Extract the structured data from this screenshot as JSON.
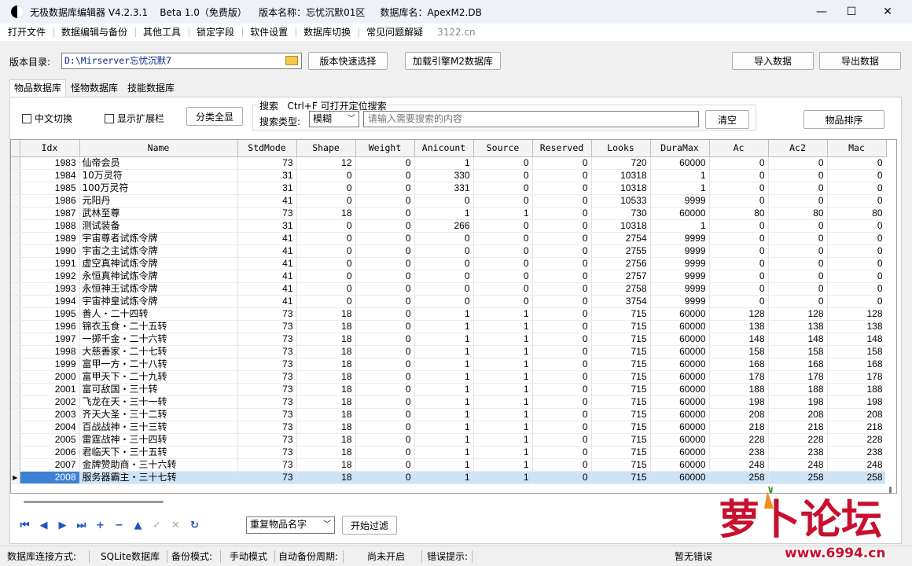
{
  "window": {
    "title": "无极数据库编辑器 V4.2.3.1    Beta 1.0（免费版）    版本名称：忘忧沉默01区     数据库名：ApexM2.DB",
    "minimize_glyph": "—",
    "maximize_glyph": "☐",
    "close_glyph": "✕"
  },
  "menu": {
    "items": [
      "打开文件",
      "数据编辑与备份",
      "其他工具",
      "锁定字段",
      "软件设置",
      "数据库切换",
      "常见问题解疑"
    ],
    "site": "3122.cn"
  },
  "toolbar": {
    "dir_label": "版本目录:",
    "dir_value": "D:\\Mirserver忘忧沉默7",
    "quick_select": "版本快速选择",
    "load_engine": "加载引擎M2数据库",
    "import": "导入数据",
    "export": "导出数据"
  },
  "tabs": [
    "物品数据库",
    "怪物数据库",
    "技能数据库"
  ],
  "options": {
    "chinese_switch": "中文切换",
    "show_ext": "显示扩展栏",
    "show_all": "分类全显",
    "search_group": "搜索   Ctrl+F 可打开定位搜索",
    "search_type_label": "搜索类型:",
    "search_type_value": "模糊",
    "search_placeholder": "请输入需要搜索的内容",
    "clear": "清空",
    "sort": "物品排序"
  },
  "grid": {
    "columns": [
      "Idx",
      "Name",
      "StdMode",
      "Shape",
      "Weight",
      "Anicount",
      "Source",
      "Reserved",
      "Looks",
      "DuraMax",
      "Ac",
      "Ac2",
      "Mac"
    ],
    "rows": [
      [
        "1983",
        "仙帝会员",
        "73",
        "12",
        "0",
        "1",
        "0",
        "0",
        "720",
        "60000",
        "0",
        "0",
        "0"
      ],
      [
        "1984",
        "10万灵符",
        "31",
        "0",
        "0",
        "330",
        "0",
        "0",
        "10318",
        "1",
        "0",
        "0",
        "0"
      ],
      [
        "1985",
        "100万灵符",
        "31",
        "0",
        "0",
        "331",
        "0",
        "0",
        "10318",
        "1",
        "0",
        "0",
        "0"
      ],
      [
        "1986",
        "元阳丹",
        "41",
        "0",
        "0",
        "0",
        "0",
        "0",
        "10533",
        "9999",
        "0",
        "0",
        "0"
      ],
      [
        "1987",
        "武林至尊",
        "73",
        "18",
        "0",
        "1",
        "1",
        "0",
        "730",
        "60000",
        "80",
        "80",
        "80"
      ],
      [
        "1988",
        "测试装备",
        "31",
        "0",
        "0",
        "266",
        "0",
        "0",
        "10318",
        "1",
        "0",
        "0",
        "0"
      ],
      [
        "1989",
        "宇宙尊者试炼令牌",
        "41",
        "0",
        "0",
        "0",
        "0",
        "0",
        "2754",
        "9999",
        "0",
        "0",
        "0"
      ],
      [
        "1990",
        "宇宙之主试炼令牌",
        "41",
        "0",
        "0",
        "0",
        "0",
        "0",
        "2755",
        "9999",
        "0",
        "0",
        "0"
      ],
      [
        "1991",
        "虚空真神试炼令牌",
        "41",
        "0",
        "0",
        "0",
        "0",
        "0",
        "2756",
        "9999",
        "0",
        "0",
        "0"
      ],
      [
        "1992",
        "永恒真神试炼令牌",
        "41",
        "0",
        "0",
        "0",
        "0",
        "0",
        "2757",
        "9999",
        "0",
        "0",
        "0"
      ],
      [
        "1993",
        "永恒神王试炼令牌",
        "41",
        "0",
        "0",
        "0",
        "0",
        "0",
        "2758",
        "9999",
        "0",
        "0",
        "0"
      ],
      [
        "1994",
        "宇宙神皇试炼令牌",
        "41",
        "0",
        "0",
        "0",
        "0",
        "0",
        "3754",
        "9999",
        "0",
        "0",
        "0"
      ],
      [
        "1995",
        "善人・二十四转",
        "73",
        "18",
        "0",
        "1",
        "1",
        "0",
        "715",
        "60000",
        "128",
        "128",
        "128"
      ],
      [
        "1996",
        "锦衣玉食・二十五转",
        "73",
        "18",
        "0",
        "1",
        "1",
        "0",
        "715",
        "60000",
        "138",
        "138",
        "138"
      ],
      [
        "1997",
        "一掷千金・二十六转",
        "73",
        "18",
        "0",
        "1",
        "1",
        "0",
        "715",
        "60000",
        "148",
        "148",
        "148"
      ],
      [
        "1998",
        "大慈善家・二十七转",
        "73",
        "18",
        "0",
        "1",
        "1",
        "0",
        "715",
        "60000",
        "158",
        "158",
        "158"
      ],
      [
        "1999",
        "富甲一方・二十八转",
        "73",
        "18",
        "0",
        "1",
        "1",
        "0",
        "715",
        "60000",
        "168",
        "168",
        "168"
      ],
      [
        "2000",
        "富甲天下・二十九转",
        "73",
        "18",
        "0",
        "1",
        "1",
        "0",
        "715",
        "60000",
        "178",
        "178",
        "178"
      ],
      [
        "2001",
        "富可敌国・三十转",
        "73",
        "18",
        "0",
        "1",
        "1",
        "0",
        "715",
        "60000",
        "188",
        "188",
        "188"
      ],
      [
        "2002",
        "飞龙在天・三十一转",
        "73",
        "18",
        "0",
        "1",
        "1",
        "0",
        "715",
        "60000",
        "198",
        "198",
        "198"
      ],
      [
        "2003",
        "齐天大圣・三十二转",
        "73",
        "18",
        "0",
        "1",
        "1",
        "0",
        "715",
        "60000",
        "208",
        "208",
        "208"
      ],
      [
        "2004",
        "百战战神・三十三转",
        "73",
        "18",
        "0",
        "1",
        "1",
        "0",
        "715",
        "60000",
        "218",
        "218",
        "218"
      ],
      [
        "2005",
        "雷霆战神・三十四转",
        "73",
        "18",
        "0",
        "1",
        "1",
        "0",
        "715",
        "60000",
        "228",
        "228",
        "228"
      ],
      [
        "2006",
        "君临天下・三十五转",
        "73",
        "18",
        "0",
        "1",
        "1",
        "0",
        "715",
        "60000",
        "238",
        "238",
        "238"
      ],
      [
        "2007",
        "金牌赞助商・三十六转",
        "73",
        "18",
        "0",
        "1",
        "1",
        "0",
        "715",
        "60000",
        "248",
        "248",
        "248"
      ],
      [
        "2008",
        "服务器霸主・三十七转",
        "73",
        "18",
        "0",
        "1",
        "1",
        "0",
        "715",
        "60000",
        "258",
        "258",
        "258"
      ]
    ],
    "selected_index": 25,
    "row_indicator": "▶"
  },
  "bottom": {
    "nav_buttons": [
      {
        "name": "first-record-icon",
        "glyph": "⏮"
      },
      {
        "name": "prior-record-icon",
        "glyph": "◀"
      },
      {
        "name": "next-record-icon",
        "glyph": "▶"
      },
      {
        "name": "last-record-icon",
        "glyph": "⏭"
      },
      {
        "name": "insert-record-icon",
        "glyph": "+"
      },
      {
        "name": "delete-record-icon",
        "glyph": "−"
      },
      {
        "name": "edit-record-icon",
        "glyph": "▲"
      },
      {
        "name": "post-edit-icon",
        "glyph": "✓"
      },
      {
        "name": "cancel-edit-icon",
        "glyph": "✕"
      },
      {
        "name": "refresh-icon",
        "glyph": "↻"
      }
    ],
    "filter_value": "重复物品名字",
    "filter_button": "开始过滤"
  },
  "status": {
    "conn_label": "数据库连接方式:",
    "conn_value": "SQLite数据库",
    "backup_label": "备份模式:",
    "backup_value": "手动模式",
    "auto_label": "自动备份周期:",
    "auto_value": "尚未开启",
    "error_label": "错误提示:",
    "error_value": "暂无错误"
  },
  "watermark": {
    "text": "萝卜论坛",
    "url": "www.6994.cn"
  },
  "colors": {
    "selection": "#cde3f7",
    "selected_cell": "#3c82d4",
    "nav_blue": "#2355c2",
    "watermark_red": "#c8102e",
    "watermark_orange": "#f28c1c"
  }
}
